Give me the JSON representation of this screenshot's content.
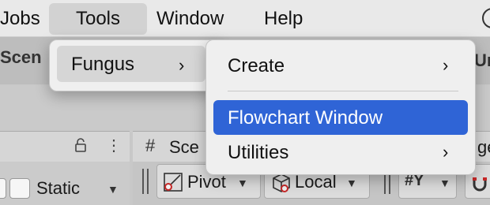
{
  "menubar": {
    "items": [
      {
        "label": "Jobs"
      },
      {
        "label": "Tools"
      },
      {
        "label": "Window"
      },
      {
        "label": "Help"
      }
    ]
  },
  "background": {
    "scene_fragment": "Scen",
    "right_fragment": "Un",
    "static_label": "Static",
    "scene_tab_label": "Sce",
    "scene_tab_right_fragment": "ge",
    "pivot_label": "Pivot",
    "local_label": "Local"
  },
  "tools_menu": {
    "items": [
      {
        "label": "Fungus",
        "submenu_arrow": "›",
        "highlighted": true
      }
    ]
  },
  "fungus_menu": {
    "items": [
      {
        "label": "Create",
        "submenu_arrow": "›"
      },
      {
        "label": "Flowchart Window",
        "selected": true
      },
      {
        "label": "Utilities",
        "submenu_arrow": "›"
      }
    ]
  },
  "colors": {
    "selection": "#2f64d6",
    "menu_bg": "#efefef",
    "menubar_bg": "#e9e9e9"
  }
}
